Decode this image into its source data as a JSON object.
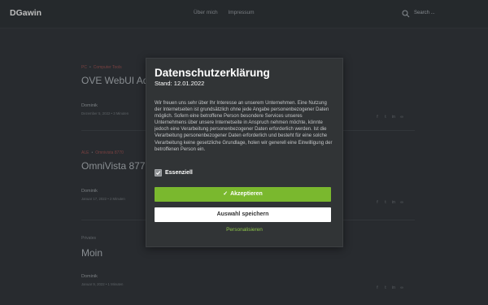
{
  "header": {
    "logo": "DGawin",
    "nav": [
      "Über mich",
      "Impressum"
    ],
    "search_placeholder": "Search ..."
  },
  "posts": [
    {
      "tags": [
        "PC",
        "Computer Tools"
      ],
      "title": "OVE WebUI Adm",
      "author": "Dominik",
      "meta": "Dezember 5, 2022 • 3 Minuten",
      "share_icons": [
        "facebook-icon",
        "twitter-icon",
        "linkedin-icon",
        "link-icon"
      ]
    },
    {
      "tags": [
        "ALE",
        "Omnivista 8770"
      ],
      "title": "OmniVista 8770 I",
      "author": "Dominik",
      "meta": "Januar 17, 2022 • 2 Minuten",
      "share_icons": [
        "facebook-icon",
        "twitter-icon",
        "linkedin-icon",
        "link-icon"
      ]
    },
    {
      "tags": [
        "Privates"
      ],
      "title": "Moin",
      "author": "Dominik",
      "meta": "Januar 9, 2022 • 1 Minuten",
      "share_icons": [
        "facebook-icon",
        "twitter-icon",
        "linkedin-icon",
        "link-icon"
      ]
    }
  ],
  "modal": {
    "title": "Datenschutzerklärung",
    "date": "Stand: 12.01.2022",
    "text": "Wir freuen uns sehr über Ihr Interesse an unserem Unternehmen. Eine Nutzung der Internetseiten ist grundsätzlich ohne jede Angabe personenbezogener Daten möglich. Sofern eine betroffene Person besondere Services unseres Unternehmens über unsere Internetseite in Anspruch nehmen möchte, könnte jedoch eine Verarbeitung personenbezogener Daten erforderlich werden. Ist die Verarbeitung personenbezogener Daten erforderlich und besteht für eine solche Verarbeitung keine gesetzliche Grundlage, holen wir generell eine Einwilligung der betroffenen Person ein.",
    "checkbox_label": "Essenziell",
    "checkbox_checked": true,
    "accept_label": "Akzeptieren",
    "save_label": "Auswahl speichern",
    "personalize_label": "Personalisieren"
  },
  "colors": {
    "accent": "#7ab82e",
    "link": "#8cc24a",
    "background": "#2e3236",
    "modal_bg": "#313436"
  }
}
